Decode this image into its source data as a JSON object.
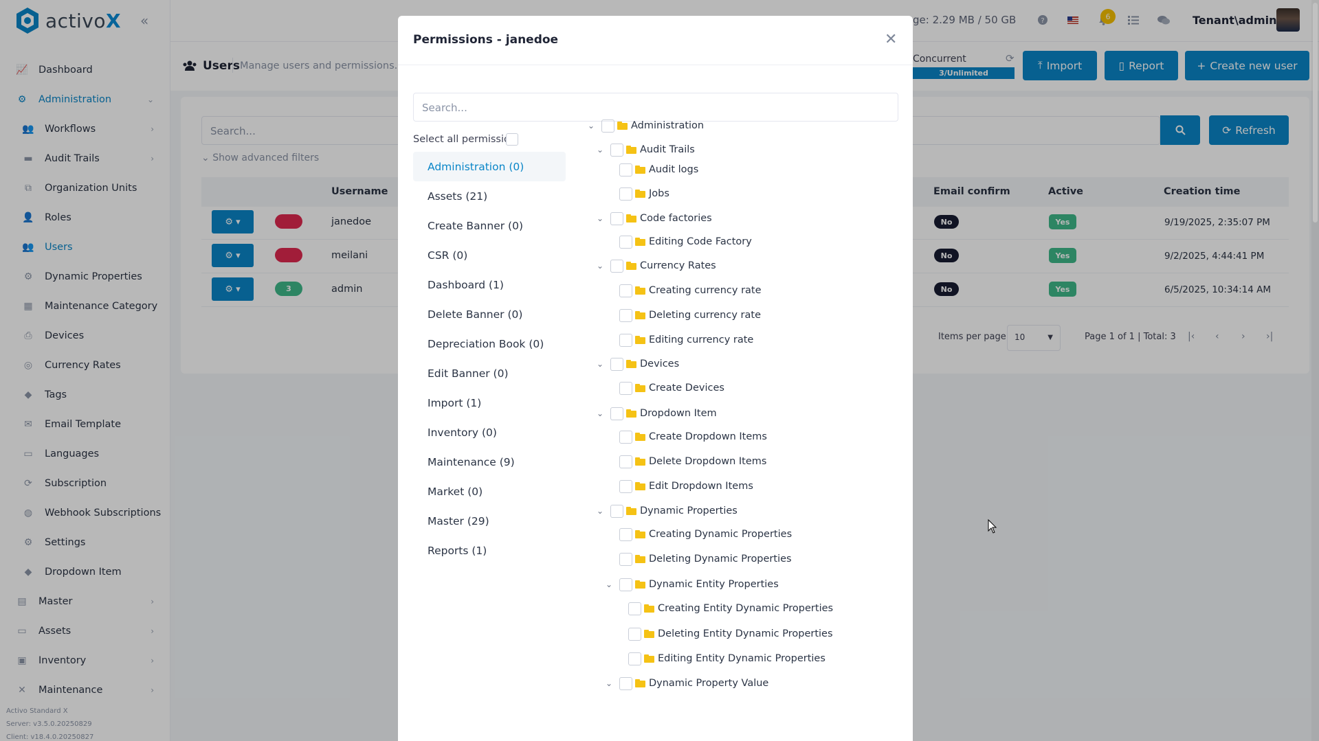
{
  "app": {
    "logo_text": "activo",
    "logo_x": "X",
    "brand_color": "#0a86c8"
  },
  "sidebar": {
    "items": [
      {
        "label": "Dashboard",
        "icon": "chart-line-icon"
      },
      {
        "label": "Administration",
        "icon": "cogs-icon"
      },
      {
        "label": "Workflows",
        "icon": "users-icon"
      },
      {
        "label": "Audit Trails",
        "icon": "folder-icon"
      },
      {
        "label": "Organization Units",
        "icon": "sitemap-icon"
      },
      {
        "label": "Roles",
        "icon": "user-icon"
      },
      {
        "label": "Users",
        "icon": "users-icon"
      },
      {
        "label": "Dynamic Properties",
        "icon": "gear-icon"
      },
      {
        "label": "Maintenance Category",
        "icon": "grid-icon"
      },
      {
        "label": "Devices",
        "icon": "printer-icon"
      },
      {
        "label": "Currency Rates",
        "icon": "coins-icon"
      },
      {
        "label": "Tags",
        "icon": "tags-icon"
      },
      {
        "label": "Email Template",
        "icon": "envelope-icon"
      },
      {
        "label": "Languages",
        "icon": "language-icon"
      },
      {
        "label": "Subscription",
        "icon": "sync-icon"
      },
      {
        "label": "Webhook Subscriptions",
        "icon": "globe-icon"
      },
      {
        "label": "Settings",
        "icon": "gear-icon"
      },
      {
        "label": "Dropdown Item",
        "icon": "tags-icon"
      },
      {
        "label": "Master",
        "icon": "database-icon"
      },
      {
        "label": "Assets",
        "icon": "laptop-icon"
      },
      {
        "label": "Inventory",
        "icon": "inbox-icon"
      },
      {
        "label": "Maintenance",
        "icon": "tools-icon"
      }
    ],
    "footer": {
      "edition": "Activo Standard X",
      "server": "Server: v3.5.0.20250829",
      "client": "Client: v18.4.0.20250827"
    }
  },
  "topbar": {
    "storage": "ge: 2.29 MB / 50 GB",
    "notification_count": "6",
    "tenant": "Tenant\\admin"
  },
  "page": {
    "title": "Users",
    "description": "Manage users and permissions.",
    "concurrent_label": "Concurrent",
    "concurrent_value": "3/Unlimited",
    "import_label": "Import",
    "report_label": "Report",
    "create_label": "Create new user",
    "search_placeholder": "Search...",
    "advanced_filters": "Show advanced filters",
    "refresh_label": "Refresh"
  },
  "table": {
    "headers": {
      "username": "Username",
      "email_confirm": "Email confirm",
      "active": "Active",
      "creation_time": "Creation time"
    },
    "rows": [
      {
        "role_count": "",
        "role_color": "#e0294f",
        "username": "janedoe",
        "email_confirm": "No",
        "active": "Yes",
        "created": "9/19/2025, 2:35:07 PM"
      },
      {
        "role_count": "",
        "role_color": "#e0294f",
        "username": "meilani",
        "email_confirm": "No",
        "active": "Yes",
        "created": "9/2/2025, 4:44:41 PM"
      },
      {
        "role_count": "3",
        "role_color": "#3fb98a",
        "username": "admin",
        "email_confirm": "No",
        "active": "Yes",
        "created": "6/5/2025, 10:34:14 AM"
      }
    ],
    "items_per_page_label": "Items per page",
    "items_per_page": "10",
    "page_info": "Page 1 of 1 | Total: 3"
  },
  "modal": {
    "title": "Permissions - janedoe",
    "search_placeholder": "Search...",
    "select_all": "Select all permission",
    "categories": [
      "Administration (0)",
      "Assets (21)",
      "Create Banner (0)",
      "CSR (0)",
      "Dashboard (1)",
      "Delete Banner (0)",
      "Depreciation Book (0)",
      "Edit Banner (0)",
      "Import (1)",
      "Inventory (0)",
      "Maintenance (9)",
      "Market (0)",
      "Master (29)",
      "Reports (1)"
    ],
    "tree": [
      {
        "label": "Administration",
        "level": 0,
        "expanded": true
      },
      {
        "label": "Audit Trails",
        "level": 1,
        "expanded": true
      },
      {
        "label": "Audit logs",
        "level": 2,
        "expanded": false
      },
      {
        "label": "Jobs",
        "level": 2,
        "expanded": false
      },
      {
        "label": "Code factories",
        "level": 1,
        "expanded": true
      },
      {
        "label": "Editing Code Factory",
        "level": 2,
        "expanded": false
      },
      {
        "label": "Currency Rates",
        "level": 1,
        "expanded": true
      },
      {
        "label": "Creating currency rate",
        "level": 2,
        "expanded": false
      },
      {
        "label": "Deleting currency rate",
        "level": 2,
        "expanded": false
      },
      {
        "label": "Editing currency rate",
        "level": 2,
        "expanded": false
      },
      {
        "label": "Devices",
        "level": 1,
        "expanded": true
      },
      {
        "label": "Create Devices",
        "level": 2,
        "expanded": false
      },
      {
        "label": "Dropdown Item",
        "level": 1,
        "expanded": true
      },
      {
        "label": "Create Dropdown Items",
        "level": 2,
        "expanded": false
      },
      {
        "label": "Delete Dropdown Items",
        "level": 2,
        "expanded": false
      },
      {
        "label": "Edit Dropdown Items",
        "level": 2,
        "expanded": false
      },
      {
        "label": "Dynamic Properties",
        "level": 1,
        "expanded": true
      },
      {
        "label": "Creating Dynamic Properties",
        "level": 2,
        "expanded": false
      },
      {
        "label": "Deleting Dynamic Properties",
        "level": 2,
        "expanded": false
      },
      {
        "label": "Dynamic Entity Properties",
        "level": 2,
        "expanded": true
      },
      {
        "label": "Creating Entity Dynamic Properties",
        "level": 3,
        "expanded": false
      },
      {
        "label": "Deleting Entity Dynamic Properties",
        "level": 3,
        "expanded": false
      },
      {
        "label": "Editing Entity Dynamic Properties",
        "level": 3,
        "expanded": false
      },
      {
        "label": "Dynamic Property Value",
        "level": 2,
        "expanded": true
      }
    ]
  }
}
